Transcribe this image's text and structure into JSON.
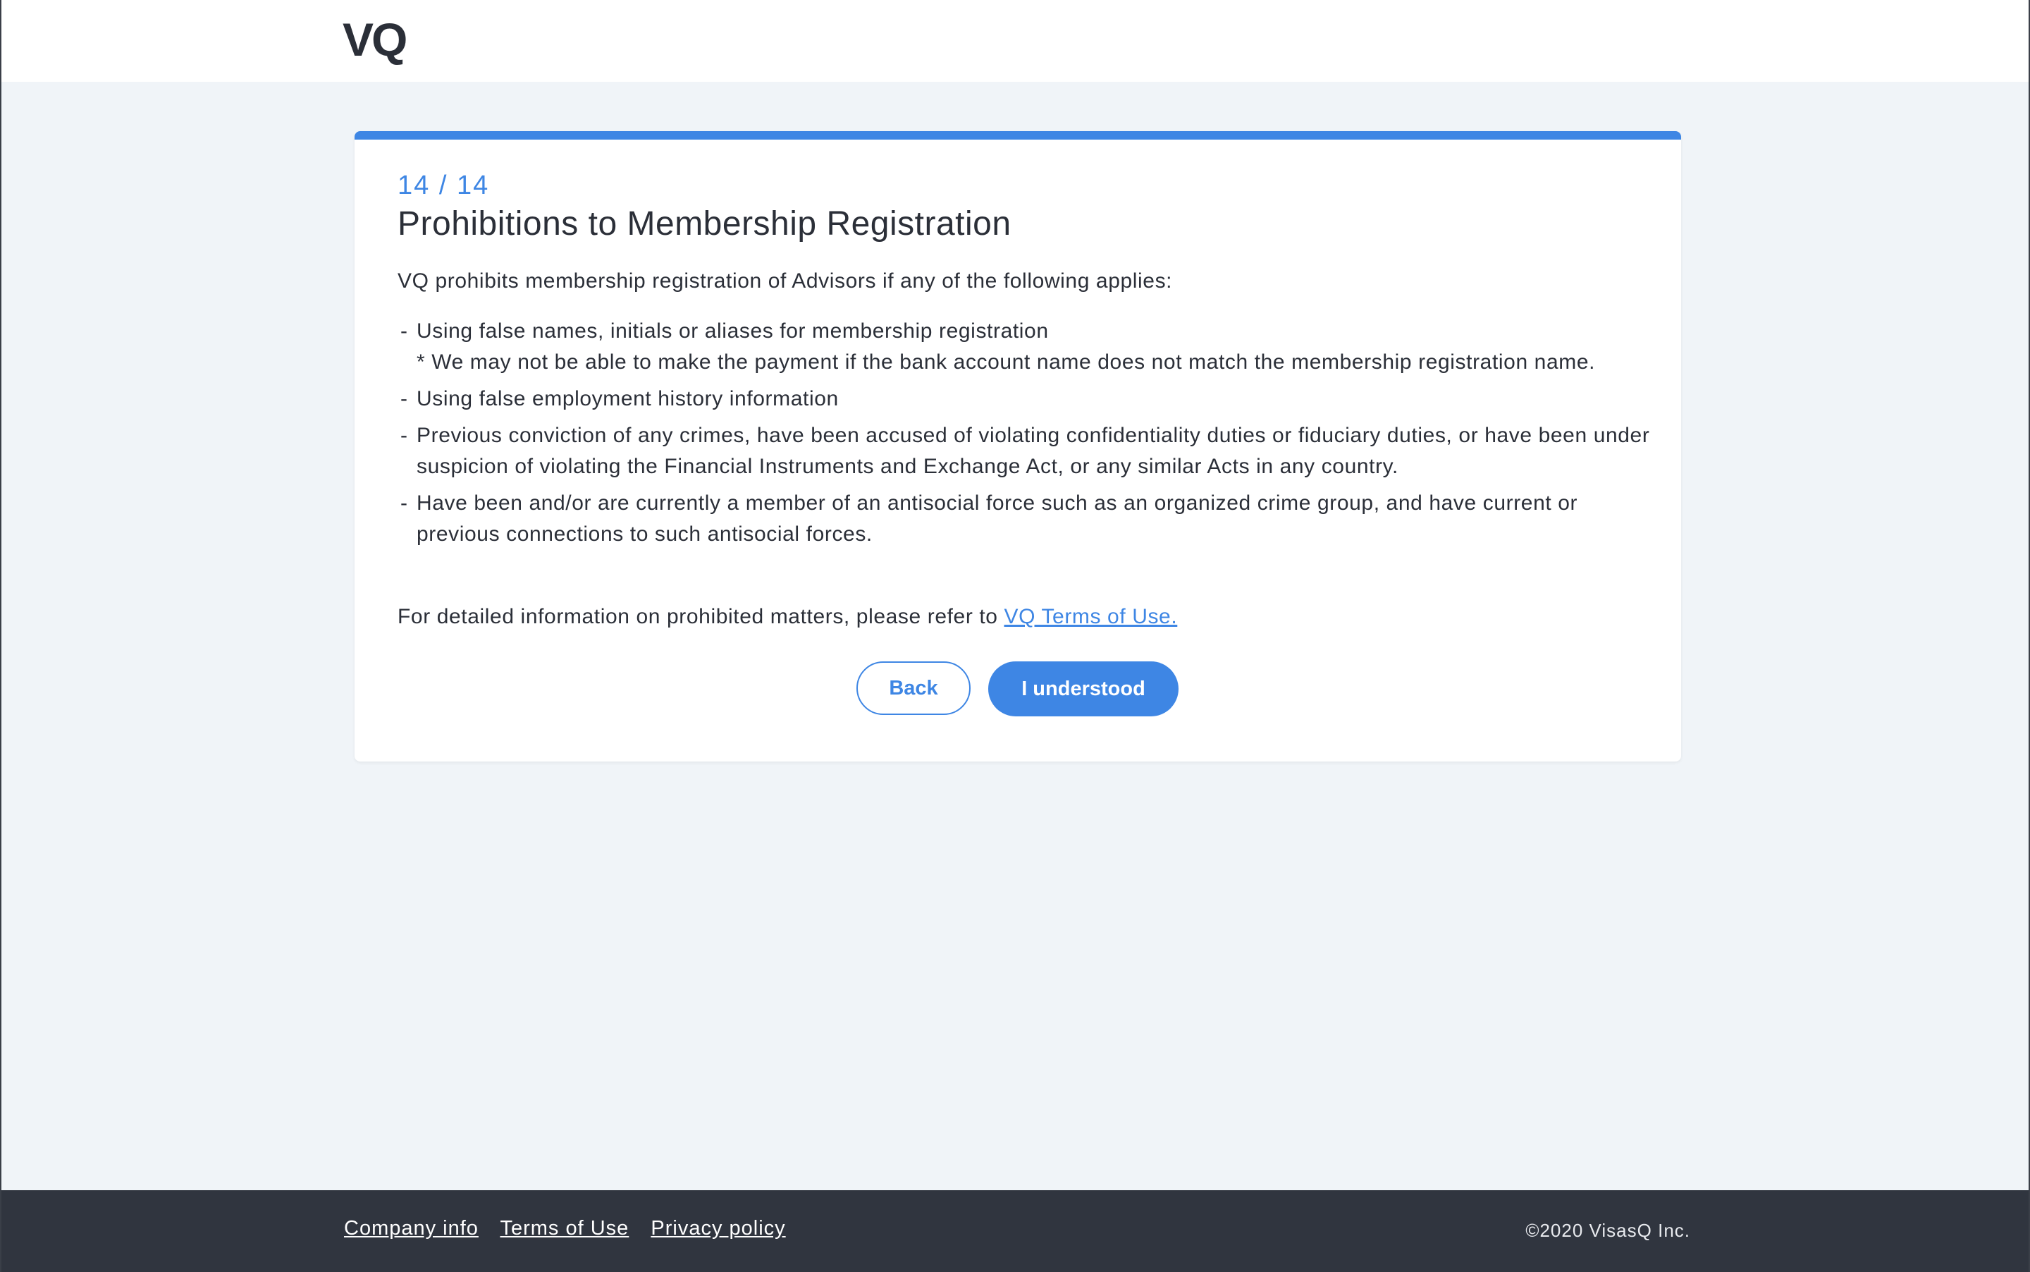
{
  "header": {
    "logo": "VQ"
  },
  "card": {
    "step": "14 / 14",
    "title": "Prohibitions to Membership Registration",
    "intro": "VQ prohibits membership registration of Advisors if any of the following applies:",
    "items": [
      {
        "text": "Using false names, initials or aliases for membership registration",
        "note": "* We may not be able to make the payment if the bank account name does not match the membership registration name."
      },
      {
        "text": "Using false employment history information"
      },
      {
        "text": "Previous conviction of any crimes, have been accused of violating confidentiality duties or fiduciary duties, or have been under suspicion of violating the Financial Instruments and Exchange Act, or any similar Acts in any country."
      },
      {
        "text": "Have been and/or are currently a member of an antisocial force such as an organized crime group, and have current or previous connections to such antisocial forces."
      }
    ],
    "refer_text": "For detailed information on prohibited matters, please refer to ",
    "refer_link": "VQ Terms of Use.",
    "back_label": "Back",
    "ok_label": "I understood"
  },
  "footer": {
    "links": [
      "Company info",
      "Terms of Use",
      "Privacy policy"
    ],
    "copyright": "©2020 VisasQ Inc."
  },
  "colors": {
    "accent": "#3e86e4",
    "page_bg": "#f0f4f8",
    "footer_bg": "#30353f"
  }
}
